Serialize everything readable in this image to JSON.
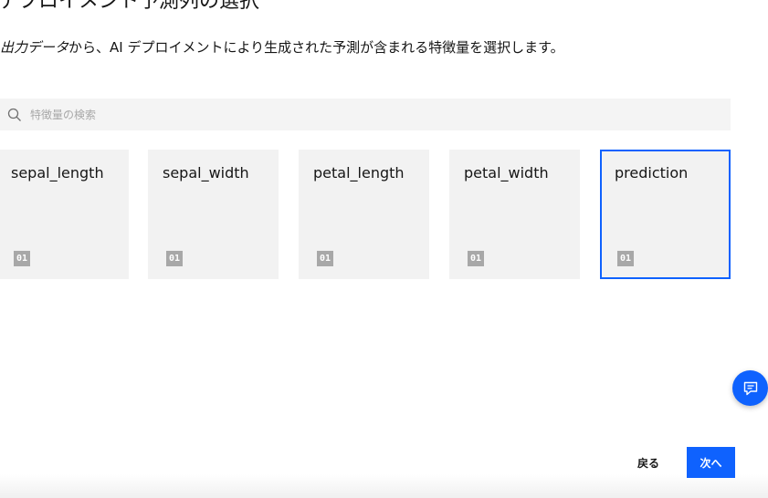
{
  "header": {
    "title": "デプロイメント予測列の選択",
    "description_emph": "出力データ",
    "description_rest": "から、AI デプロイメントにより生成された予測が含まれる特徴量を選択します。"
  },
  "search": {
    "placeholder": "特徴量の検索",
    "value": "",
    "icon": "search-icon"
  },
  "columns": [
    {
      "label": "sepal_length",
      "type_badge": "01",
      "selected": false
    },
    {
      "label": "sepal_width",
      "type_badge": "01",
      "selected": false
    },
    {
      "label": "petal_length",
      "type_badge": "01",
      "selected": false
    },
    {
      "label": "petal_width",
      "type_badge": "01",
      "selected": false
    },
    {
      "label": "prediction",
      "type_badge": "01",
      "selected": true
    }
  ],
  "chat": {
    "icon": "chat-icon"
  },
  "footer": {
    "back_label": "戻る",
    "next_label": "次へ"
  },
  "colors": {
    "accent": "#0f62fe",
    "tile_background": "#f2f2f2",
    "search_background": "#f4f4f4"
  }
}
